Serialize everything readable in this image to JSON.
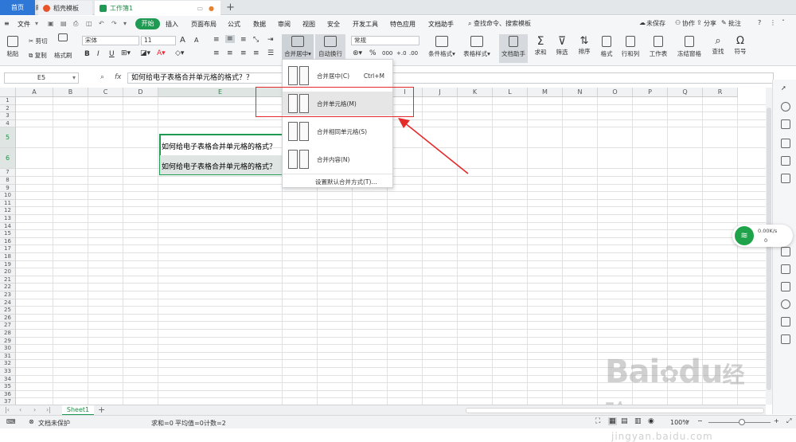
{
  "tabs": {
    "home": "首页",
    "template": "稻壳模板",
    "workbook": "工作簿1"
  },
  "titlebar": {
    "badge": "1",
    "user": "同威"
  },
  "menu": {
    "file": "文件",
    "items": [
      "开始",
      "插入",
      "页面布局",
      "公式",
      "数据",
      "审阅",
      "视图",
      "安全",
      "开发工具",
      "特色应用",
      "文档助手"
    ],
    "search": "查找命令、搜索模板",
    "unsaved": "未保存",
    "collab": "协作",
    "share": "分享",
    "comment": "批注"
  },
  "ribbon": {
    "paste": "粘贴",
    "cut": "剪切",
    "copy": "复制",
    "format_painter": "格式刷",
    "font_name": "宋体",
    "font_size": "11",
    "merge_center": "合并居中",
    "wrap": "自动换行",
    "number_format": "常规",
    "cond_format": "条件格式",
    "table_style": "表格样式",
    "doc_helper": "文档助手",
    "sum": "求和",
    "filter": "筛选",
    "sort": "排序",
    "format": "格式",
    "rowcol": "行和列",
    "worksheet": "工作表",
    "freeze": "冻结窗格",
    "find": "查找",
    "symbol": "符号",
    "bold": "B",
    "italic": "I",
    "underline": "U",
    "grow_font": "A",
    "shrink_font": "A",
    "percent": "%",
    "thousands": "000",
    "inc_decimal": "+.0",
    "dec_decimal": ".00"
  },
  "formula": {
    "name_box": "E5",
    "fx": "fx",
    "content": "如何给电子表格合并单元格的格式？？"
  },
  "columns": [
    "A",
    "B",
    "C",
    "D",
    "E",
    "F",
    "G",
    "H",
    "I",
    "J",
    "K",
    "L",
    "M",
    "N",
    "O",
    "P",
    "Q",
    "R"
  ],
  "rows": [
    "1",
    "2",
    "3",
    "4",
    "5",
    "6",
    "7",
    "8",
    "9",
    "10",
    "11",
    "12",
    "13",
    "14",
    "15",
    "16",
    "17",
    "18",
    "19",
    "20",
    "21",
    "22",
    "23",
    "24",
    "25",
    "26",
    "27",
    "28",
    "29",
    "30",
    "31",
    "32",
    "33",
    "34",
    "35",
    "36",
    "37",
    "38"
  ],
  "cells": {
    "E5": "如何给电子表格合并单元格的格式？",
    "E6": "如何给电子表格合并单元格的格式？"
  },
  "dropdown": {
    "items": [
      {
        "label": "合并居中(C)",
        "shortcut": "Ctrl+M"
      },
      {
        "label": "合并单元格(M)",
        "shortcut": ""
      },
      {
        "label": "合并相同单元格(S)",
        "shortcut": ""
      },
      {
        "label": "合并内容(N)",
        "shortcut": ""
      }
    ],
    "default_setting": "设置默认合并方式(T)..."
  },
  "network": {
    "speed": "0.00K/s",
    "count": "0"
  },
  "sheets": {
    "active": "Sheet1"
  },
  "status": {
    "protect": "文档未保护",
    "sum": "求和=0",
    "average": "平均值=0",
    "count": "计数=2",
    "zoom": "100%"
  },
  "watermark": {
    "brand": "Bai",
    "brand2": "du",
    "cn": "经验",
    "url": "jingyan.baidu.com"
  },
  "colors": {
    "accent_green": "#1f9a52",
    "home_blue": "#2f77d6",
    "annotation_red": "#e52a2a"
  }
}
